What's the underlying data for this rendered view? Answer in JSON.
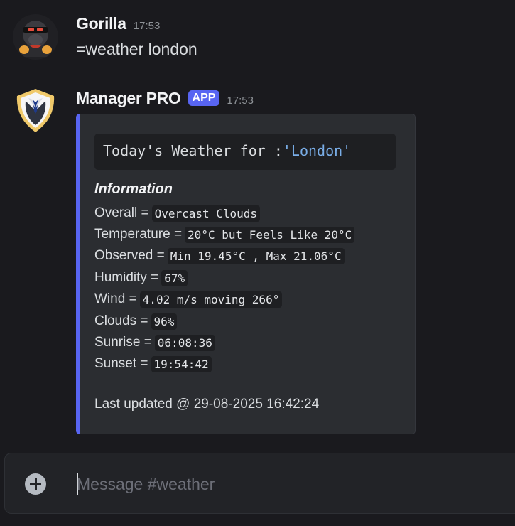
{
  "messages": [
    {
      "username": "Gorilla",
      "timestamp": "17:53",
      "content": "=weather london"
    },
    {
      "username": "Manager PRO",
      "badge": "APP",
      "timestamp": "17:53",
      "embed": {
        "code_prefix": "Today's Weather for :",
        "code_string": "'London'",
        "heading": "Information",
        "fields": [
          {
            "label": "Overall =",
            "value": "Overcast Clouds"
          },
          {
            "label": "Temperature =",
            "value": "20°C but Feels Like 20°C"
          },
          {
            "label": "Observed =",
            "value": "Min 19.45°C , Max 21.06°C"
          },
          {
            "label": "Humidity =",
            "value": "67%"
          },
          {
            "label": "Wind =",
            "value": "4.02 m/s moving 266°"
          },
          {
            "label": "Clouds =",
            "value": "96%"
          },
          {
            "label": "Sunrise =",
            "value": "06:08:36"
          },
          {
            "label": "Sunset =",
            "value": "19:54:42"
          }
        ],
        "footer": "Last updated @ 29-08-2025 16:42:24"
      }
    }
  ],
  "composer": {
    "placeholder": "Message #weather"
  },
  "colors": {
    "background": "#1a1a1e",
    "embed_accent": "#5865f2",
    "app_badge": "#5865f2",
    "code_string": "#7aaee8"
  },
  "icons": {
    "user_avatar": "gorilla-avatar",
    "bot_avatar": "shield-suit-avatar",
    "add": "plus-circle-icon"
  }
}
